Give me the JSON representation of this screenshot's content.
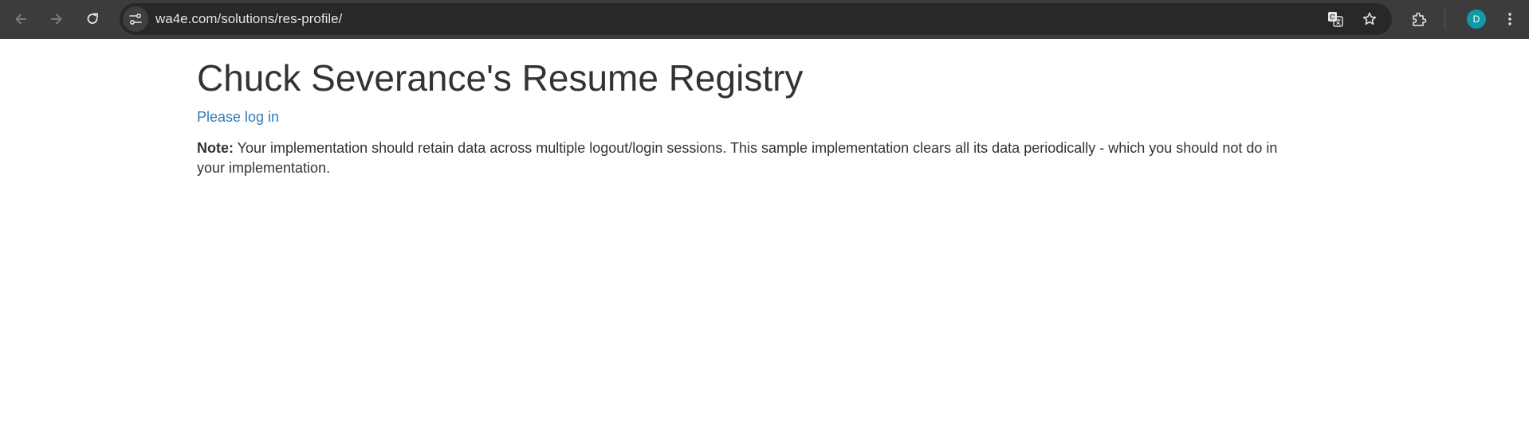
{
  "browser": {
    "url": "wa4e.com/solutions/res-profile/",
    "avatar_letter": "D",
    "icons": {
      "back": "arrow-left-icon",
      "forward": "arrow-right-icon",
      "reload": "reload-icon",
      "site_info": "tune-icon",
      "translate": "translate-icon",
      "bookmark": "star-icon",
      "extensions": "puzzle-icon",
      "menu": "kebab-menu-icon"
    },
    "colors": {
      "toolbar": "#3c3c3c",
      "omnibox": "#282828",
      "avatar": "#0e9aa7"
    }
  },
  "page": {
    "title": "Chuck Severance's Resume Registry",
    "login_link": "Please log in",
    "note_label": "Note:",
    "note_text": " Your implementation should retain data across multiple logout/login sessions. This sample implementation clears all its data periodically - which you should not do in your implementation.",
    "colors": {
      "text": "#333333",
      "link": "#337ab7"
    }
  }
}
